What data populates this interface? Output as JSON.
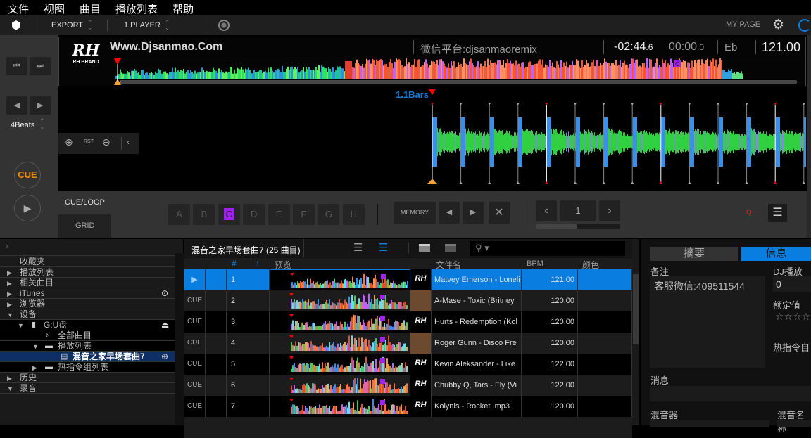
{
  "menu": [
    "文件",
    "视图",
    "曲目",
    "播放列表",
    "帮助"
  ],
  "toolbar": {
    "export": "EXPORT",
    "player": "1 PLAYER",
    "my_page": "MY PAGE"
  },
  "deck": {
    "title": "Www.Djsanmao.Com",
    "artist": "微信平台:djsanmaoremix",
    "remaining_main": "-02:44",
    "remaining_frac": ".6",
    "elapsed_main": "00:00",
    "elapsed_frac": ".0",
    "key": "Eb",
    "bpm": "121.00",
    "logo_text": "RH BRAND",
    "beat_jump": "4Beats",
    "cue": "CUE",
    "bars_label": "1.1Bars",
    "zoom_reset": "RST",
    "tabs": [
      "CUE/LOOP",
      "GRID"
    ],
    "hotcues": [
      "A",
      "B",
      "C",
      "D",
      "E",
      "F",
      "G",
      "H"
    ],
    "active_hotcue": "C",
    "memory": "MEMORY",
    "memory_index": "1",
    "memory_progress": 0.49,
    "quantize": "Q",
    "colors": {
      "accent": "#0a7ee0",
      "cue": "#f08c00",
      "hotcue_c": "#a020f0",
      "quantize": "#e02020"
    }
  },
  "tree": [
    {
      "label": "收藏夹",
      "arrow": "",
      "indent": 0
    },
    {
      "label": "播放列表",
      "arrow": "▶",
      "indent": 0
    },
    {
      "label": "相关曲目",
      "arrow": "▶",
      "indent": 0
    },
    {
      "label": "iTunes",
      "arrow": "▶",
      "indent": 0
    },
    {
      "label": "浏览器",
      "arrow": "▶",
      "indent": 0
    },
    {
      "label": "设备",
      "arrow": "▼",
      "indent": 0
    },
    {
      "label": "G:U盘",
      "arrow": "▼",
      "indent": 1
    },
    {
      "label": "全部曲目",
      "arrow": "",
      "indent": 2
    },
    {
      "label": "播放列表",
      "arrow": "▼",
      "indent": 2
    },
    {
      "label": "混音之家早场套曲7",
      "arrow": "",
      "indent": 3
    },
    {
      "label": "热指令组列表",
      "arrow": "▶",
      "indent": 2
    },
    {
      "label": "历史",
      "arrow": "▶",
      "indent": 0
    },
    {
      "label": "录音",
      "arrow": "▼",
      "indent": 0
    }
  ],
  "browser": {
    "playlist_title": "混音之家早场套曲7 (25 曲目)",
    "columns": {
      "num": "#",
      "preview": "预览",
      "filename": "文件名",
      "bpm": "BPM",
      "color": "颜色"
    },
    "rows": [
      {
        "cue": "",
        "num": "1",
        "file": "Matvey Emerson - Loneli",
        "bpm": "121.00"
      },
      {
        "cue": "CUE",
        "num": "2",
        "file": "A-Mase - Toxic (Britney",
        "bpm": "120.00"
      },
      {
        "cue": "CUE",
        "num": "3",
        "file": "Hurts - Redemption (Kol",
        "bpm": "120.00"
      },
      {
        "cue": "CUE",
        "num": "4",
        "file": "Roger Gunn - Disco Fre",
        "bpm": "120.00"
      },
      {
        "cue": "CUE",
        "num": "5",
        "file": "Kevin Aleksander - Like",
        "bpm": "122.00"
      },
      {
        "cue": "CUE",
        "num": "6",
        "file": "Chubby Q, Tars - Fly (Vi",
        "bpm": "122.00"
      },
      {
        "cue": "CUE",
        "num": "7",
        "file": "Kolynis - Rocket .mp3",
        "bpm": "120.00"
      }
    ]
  },
  "info": {
    "tabs": [
      "摘要",
      "信息"
    ],
    "active_tab": "信息",
    "comment_label": "备注",
    "comment": "客服微信:409511544",
    "play_count_label": "DJ播放计",
    "play_count": "0",
    "rating_label": "额定值",
    "rating": 0,
    "hotcue_label": "热指令自",
    "message_label": "消息",
    "mixer_label": "混音器",
    "mix_name_label": "混音名称"
  }
}
